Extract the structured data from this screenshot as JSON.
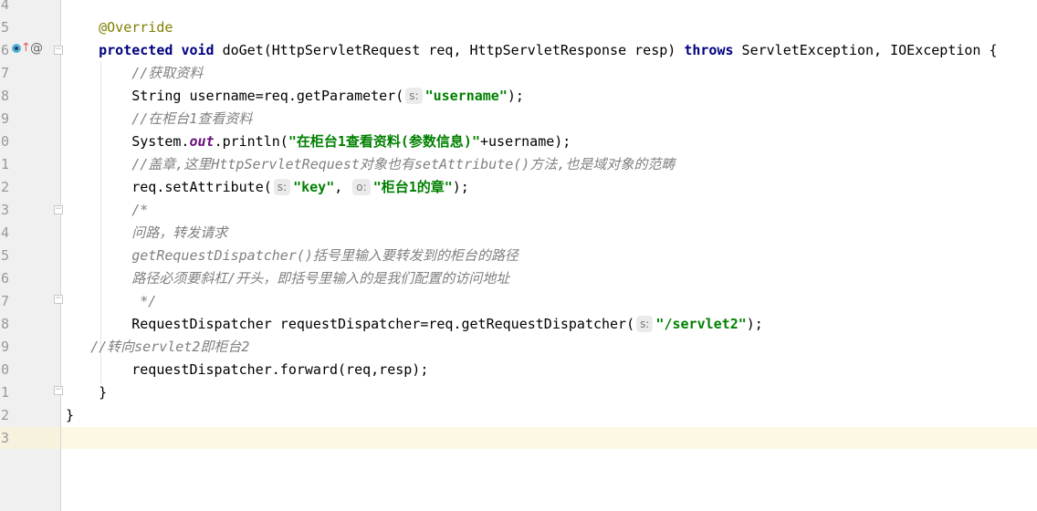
{
  "editor": {
    "gutter_numbers": [
      "4",
      "5",
      "6",
      "7",
      "8",
      "9",
      "0",
      "1",
      "2",
      "3",
      "4",
      "5",
      "6",
      "7",
      "8",
      "9",
      "0",
      "1",
      "2",
      "3"
    ],
    "gutter_marks": {
      "implementing_icon": "override-method-icon",
      "annotation_icon": "at-sign-icon"
    },
    "current_line_index": 19,
    "lines": [
      [],
      [
        [
          "an",
          "    @Override"
        ]
      ],
      [
        [
          "",
          "    "
        ],
        [
          "kw",
          "protected"
        ],
        [
          "",
          " "
        ],
        [
          "kw",
          "void"
        ],
        [
          "",
          " doGet(HttpServletRequest req, HttpServletResponse resp) "
        ],
        [
          "kw",
          "throws"
        ],
        [
          "",
          " ServletException, IOException {"
        ]
      ],
      [
        [
          "cm",
          "        //获取资料"
        ]
      ],
      [
        [
          "",
          "        String username=req.getParameter("
        ],
        [
          "hint",
          "s:"
        ],
        [
          "str",
          "\"username\""
        ],
        [
          "",
          ");"
        ]
      ],
      [
        [
          "cm",
          "        //在柜台1查看资料"
        ]
      ],
      [
        [
          "",
          "        System."
        ],
        [
          "fld",
          "out"
        ],
        [
          "",
          ".println("
        ],
        [
          "str",
          "\"在柜台1查看资料(参数信息)\""
        ],
        [
          "",
          "+username);"
        ]
      ],
      [
        [
          "cm",
          "        //盖章,这里HttpServletRequest对象也有setAttribute()方法,也是域对象的范畴"
        ]
      ],
      [
        [
          "",
          "        req.setAttribute("
        ],
        [
          "hint",
          "s:"
        ],
        [
          "str",
          "\"key\""
        ],
        [
          "",
          ", "
        ],
        [
          "hint",
          "o:"
        ],
        [
          "str",
          "\"柜台1的章\""
        ],
        [
          "",
          ");"
        ]
      ],
      [
        [
          "cm",
          "        /*"
        ]
      ],
      [
        [
          "cm",
          "        问路，转发请求"
        ]
      ],
      [
        [
          "cm",
          "        getRequestDispatcher()括号里输入要转发到的柜台的路径"
        ]
      ],
      [
        [
          "cm",
          "        路径必须要斜杠/开头，即括号里输入的是我们配置的访问地址"
        ]
      ],
      [
        [
          "cm",
          "         */"
        ]
      ],
      [
        [
          "",
          "        RequestDispatcher requestDispatcher=req.getRequestDispatcher("
        ],
        [
          "hint",
          "s:"
        ],
        [
          "str",
          "\"/servlet2\""
        ],
        [
          "",
          ");"
        ]
      ],
      [
        [
          "cm",
          "   //转向servlet2即柜台2"
        ]
      ],
      [
        [
          "",
          "        requestDispatcher.forward(req,resp);"
        ]
      ],
      [
        [
          "",
          "    }"
        ]
      ],
      [
        [
          "",
          "}"
        ]
      ],
      []
    ]
  }
}
